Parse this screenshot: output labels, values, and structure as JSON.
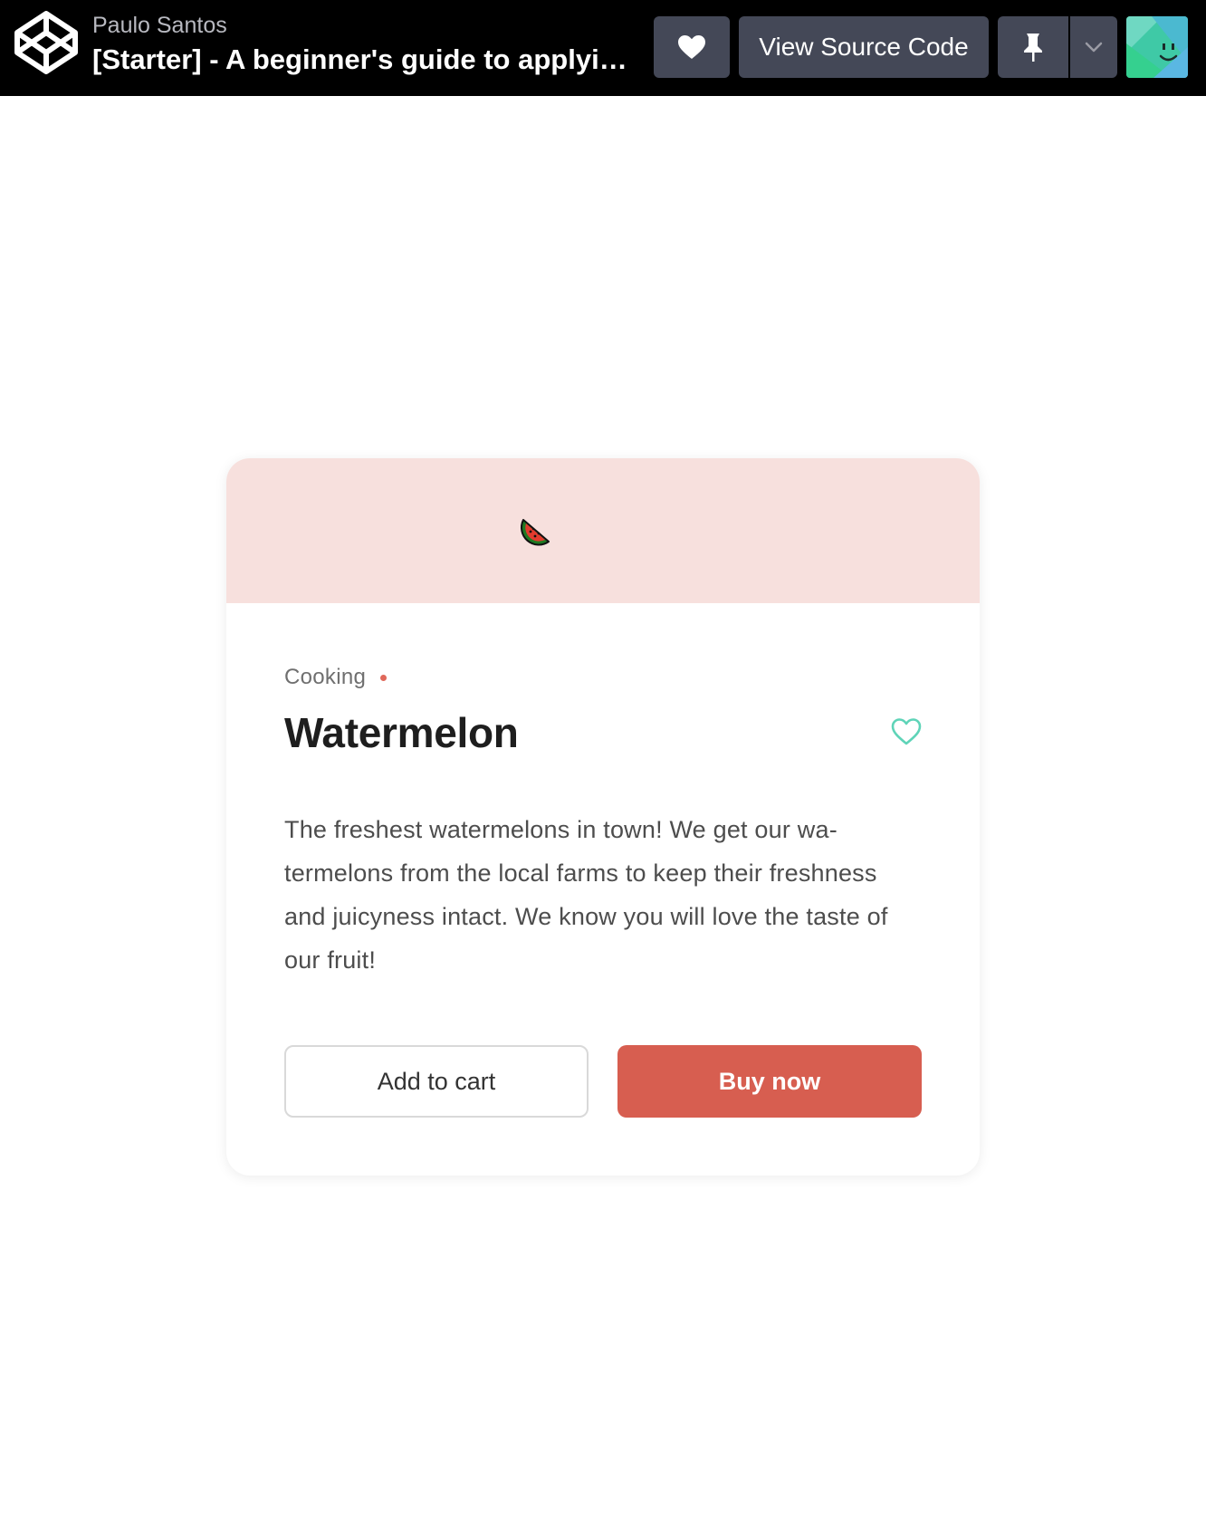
{
  "topbar": {
    "author": "Paulo Santos",
    "title": "[Starter] - A beginner's guide to applying c...",
    "view_source_label": "View Source Code",
    "logo_icon": "codepen-logo-icon",
    "heart_icon": "heart-icon",
    "pin_icon": "pin-icon",
    "caret_icon": "chevron-down-icon",
    "avatar_icon": "avatar-smiley-icon"
  },
  "card": {
    "hero_icon": "watermelon-icon",
    "hero_color": "#f7e0dd",
    "category": "Cooking",
    "name": "Watermelon",
    "favorite_icon": "heart-outline-icon",
    "description": "The freshest watermelons in town! We get our wa­termelons from the local farms to keep their fresh­ness and juicyness intact. We know you will love the taste of our fruit!",
    "add_to_cart_label": "Add to cart",
    "buy_now_label": "Buy now",
    "accent_color": "#d75e50",
    "favorite_color": "#5fd4b8"
  }
}
